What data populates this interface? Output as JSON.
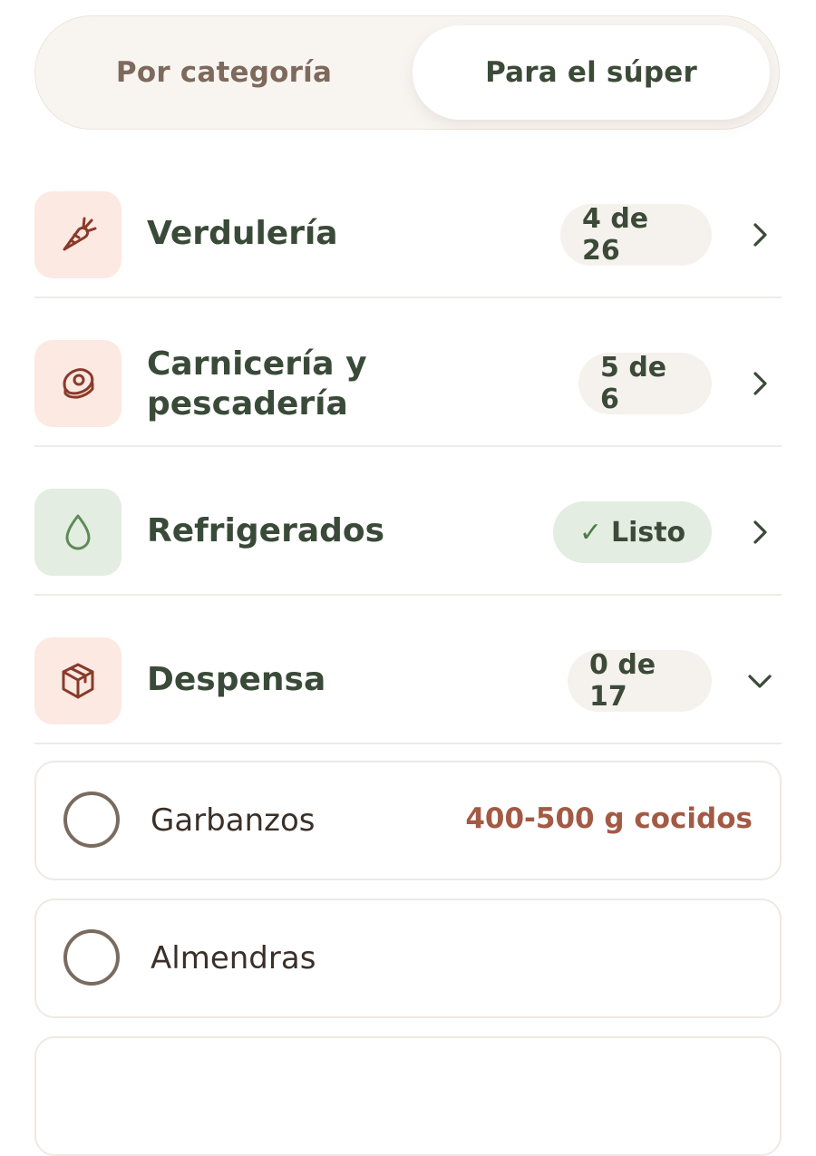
{
  "segmented": {
    "left_label": "Por categoría",
    "right_label": "Para el súper"
  },
  "categories": [
    {
      "title": "Verdulería",
      "badge": "4 de 26",
      "icon": "carrot-icon"
    },
    {
      "title_line1": "Carnicería y",
      "title_line2": "pescadería",
      "badge": "5 de 6",
      "icon": "meat-icon"
    },
    {
      "title": "Refrigerados",
      "badge": "Listo",
      "badge_check": "✓",
      "icon": "drop-icon"
    },
    {
      "title": "Despensa",
      "badge": "0 de 17",
      "icon": "box-icon",
      "expanded": true
    }
  ],
  "items": [
    {
      "name": "Garbanzos",
      "qty": "400-500 g cocidos"
    },
    {
      "name": "Almendras",
      "qty": ""
    }
  ],
  "colors": {
    "accent_text": "#3a4a38",
    "quantity": "#a35a44",
    "icon_bg_warm": "#fbe9e2",
    "icon_bg_green": "#e3ede2",
    "icon_stroke_warm": "#8a3a2a",
    "icon_stroke_green": "#5e8a57"
  }
}
